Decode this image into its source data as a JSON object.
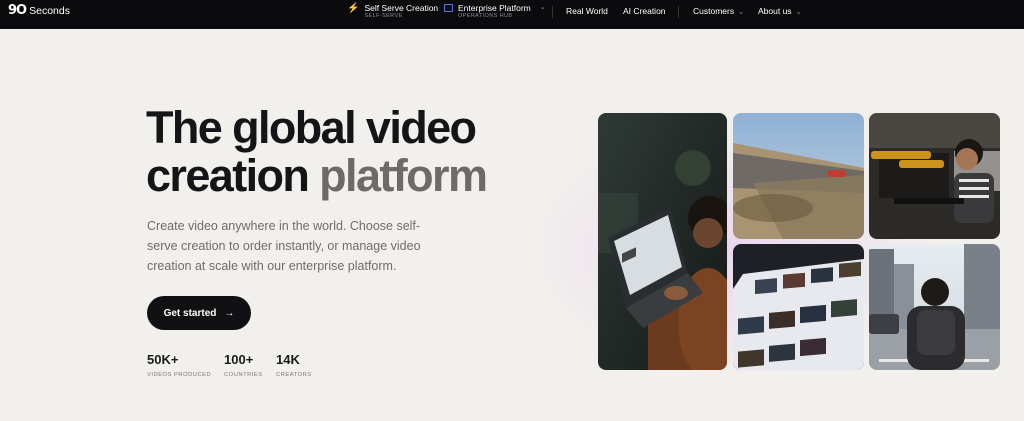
{
  "nav": {
    "logo_mark": "9O",
    "logo_text": "Seconds",
    "self_serve": {
      "label": "Self Serve Creation",
      "sub": "SELF-SERVE"
    },
    "enterprise": {
      "label": "Enterprise Platform",
      "sub": "OPERATIONS HUB"
    },
    "real_world": "Real World",
    "ai_creation": "AI Creation",
    "customers": "Customers",
    "about": "About us",
    "caret": "⌄",
    "bolt": "⚡"
  },
  "hero": {
    "title_line1": "The global video",
    "title_line2_dark": "creation ",
    "title_line2_grey": "platform",
    "description": "Create video anywhere in the world. Choose self-serve creation to order instantly, or manage video creation at scale with our enterprise platform.",
    "cta_label": "Get started",
    "cta_arrow": "→"
  },
  "stats": [
    {
      "value": "50K+",
      "label": "VIDEOS PRODUCED"
    },
    {
      "value": "100+",
      "label": "COUNTRIES"
    },
    {
      "value": "14K",
      "label": "CREATORS"
    }
  ],
  "colors": {
    "nav_bg": "#0b0b0d",
    "page_bg": "#f2f0ed",
    "accent_purple": "#a98bf5",
    "accent_blue": "#5b7be6"
  }
}
